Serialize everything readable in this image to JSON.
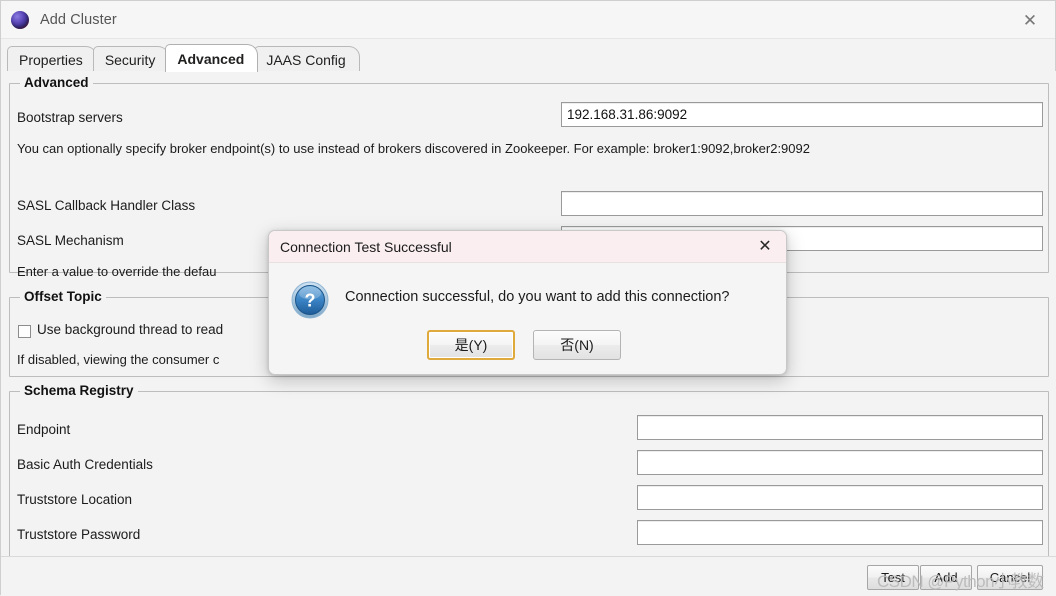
{
  "window": {
    "title": "Add Cluster",
    "icon": "kafka-sphere-icon",
    "close_label": "✕"
  },
  "tabs": [
    {
      "label": "Properties",
      "active": false
    },
    {
      "label": "Security",
      "active": false
    },
    {
      "label": "Advanced",
      "active": true
    },
    {
      "label": "JAAS Config",
      "active": false
    }
  ],
  "advanced_group": {
    "title": "Advanced",
    "bootstrap_label": "Bootstrap servers",
    "bootstrap_value": "192.168.31.86:9092",
    "bootstrap_help": "You can optionally specify broker endpoint(s) to use instead of brokers discovered in Zookeeper. For example: broker1:9092,broker2:9092",
    "sasl_callback_label": "SASL Callback Handler Class",
    "sasl_callback_value": "",
    "sasl_mechanism_label": "SASL Mechanism",
    "sasl_mechanism_value": "",
    "sasl_help": "Enter a value to override the defau"
  },
  "offset_topic_group": {
    "title": "Offset Topic",
    "checkbox_label": "Use background thread to read",
    "checkbox_checked": false,
    "help": "If disabled, viewing the consumer c"
  },
  "schema_registry_group": {
    "title": "Schema Registry",
    "rows": [
      {
        "label": "Endpoint",
        "value": ""
      },
      {
        "label": "Basic Auth Credentials",
        "value": ""
      },
      {
        "label": "Truststore Location",
        "value": ""
      },
      {
        "label": "Truststore Password",
        "value": ""
      }
    ]
  },
  "footer": {
    "test_label": "Test",
    "add_label": "Add",
    "cancel_label": "Cancel",
    "watermark": "CSDN @Python小教数"
  },
  "modal": {
    "title": "Connection Test Successful",
    "close_label": "✕",
    "icon": "question-mark-icon",
    "message": "Connection successful, do you want to add this connection?",
    "yes_label": "是(Y)",
    "no_label": "否(N)",
    "focused_button": "yes"
  },
  "colors": {
    "modal_header": "#faeef0",
    "focus_ring": "#e0a93c",
    "panel": "#f3f3f3",
    "icon_blue": "#2f7fc4"
  }
}
